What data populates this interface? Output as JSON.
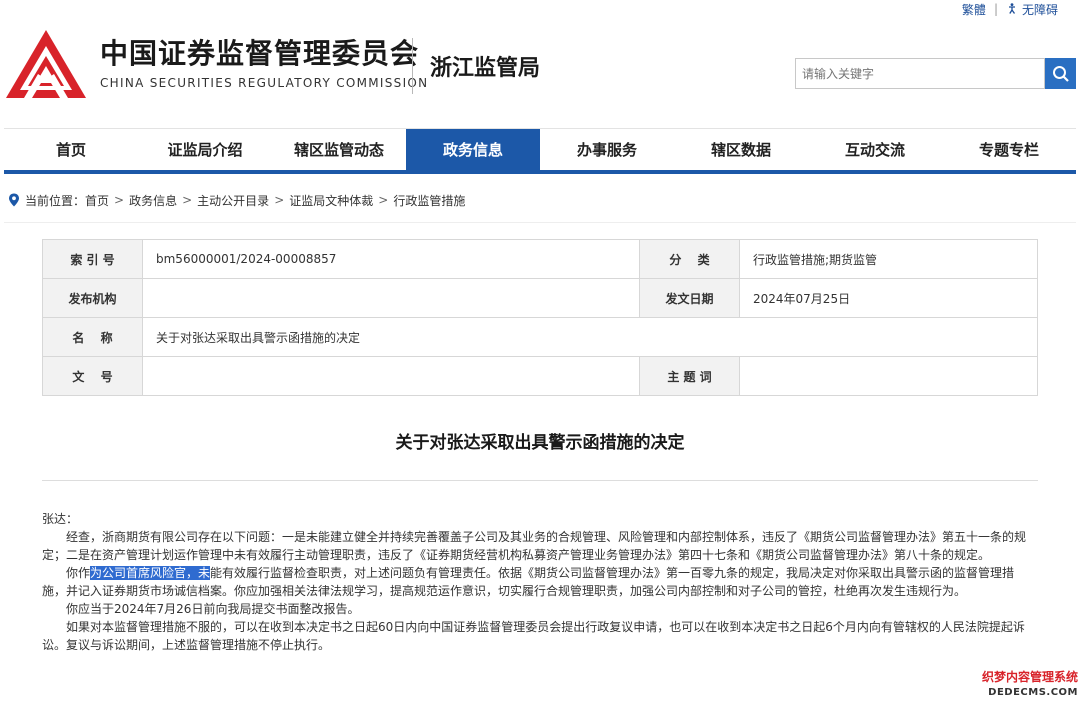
{
  "top_links": {
    "traditional": "繁體",
    "accessible": "无障碍"
  },
  "header": {
    "org_cn": "中国证券监督管理委员会",
    "org_en": "CHINA SECURITIES REGULATORY COMMISSION",
    "bureau": "浙江监管局",
    "search_placeholder": "请输入关键字",
    "brand_color": "#d8232a",
    "accent_color": "#1c58a8"
  },
  "nav": {
    "items": [
      {
        "label": "首页"
      },
      {
        "label": "证监局介绍"
      },
      {
        "label": "辖区监管动态"
      },
      {
        "label": "政务信息"
      },
      {
        "label": "办事服务"
      },
      {
        "label": "辖区数据"
      },
      {
        "label": "互动交流"
      },
      {
        "label": "专题专栏"
      }
    ],
    "active": "政务信息"
  },
  "breadcrumb": {
    "prefix": "当前位置：",
    "items": [
      "首页",
      "政务信息",
      "主动公开目录",
      "证监局文种体裁",
      "行政监管措施"
    ],
    "separator": ">"
  },
  "info": {
    "index_label": "索 引 号",
    "index_value": "bm56000001/2024-00008857",
    "category_label": "分　 类",
    "category_value": "行政监管措施;期货监管",
    "issuer_label": "发布机构",
    "issuer_value": "",
    "date_label": "发文日期",
    "date_value": "2024年07月25日",
    "name_label": "名　 称",
    "name_value": "关于对张达采取出具警示函措施的决定",
    "docno_label": "文　 号",
    "docno_value": "",
    "keywords_label": "主 题 词",
    "keywords_value": ""
  },
  "doc": {
    "title": "关于对张达采取出具警示函措施的决定",
    "salutation": "张达：",
    "p1": "经查，浙商期货有限公司存在以下问题：一是未能建立健全并持续完善覆盖子公司及其业务的合规管理、风险管理和内部控制体系，违反了《期货公司监督管理办法》第五十一条的规定；二是在资产管理计划运作管理中未有效履行主动管理职责，违反了《证券期货经营机构私募资产管理业务管理办法》第四十七条和《期货公司监督管理办法》第八十条的规定。",
    "p2_pre": "你作",
    "p2_hl": "为公司首席风险官，未",
    "p2_post": "能有效履行监督检查职责，对上述问题负有管理责任。依据《期货公司监督管理办法》第一百零九条的规定，我局决定对你采取出具警示函的监督管理措施，并记入证券期货市场诚信档案。你应加强相关法律法规学习，提高规范运作意识，切实履行合规管理职责，加强公司内部控制和对子公司的管控，杜绝再次发生违规行为。",
    "p3": "你应当于2024年7月26日前向我局提交书面整改报告。",
    "p4": "如果对本监督管理措施不服的，可以在收到本决定书之日起60日内向中国证券监督管理委员会提出行政复议申请，也可以在收到本决定书之日起6个月内向有管辖权的人民法院提起诉讼。复议与诉讼期间，上述监督管理措施不停止执行。",
    "highlight_color": "#2f6bd0"
  },
  "watermark": {
    "cn": "织梦内容管理系统",
    "en": "DEDECMS.COM"
  }
}
